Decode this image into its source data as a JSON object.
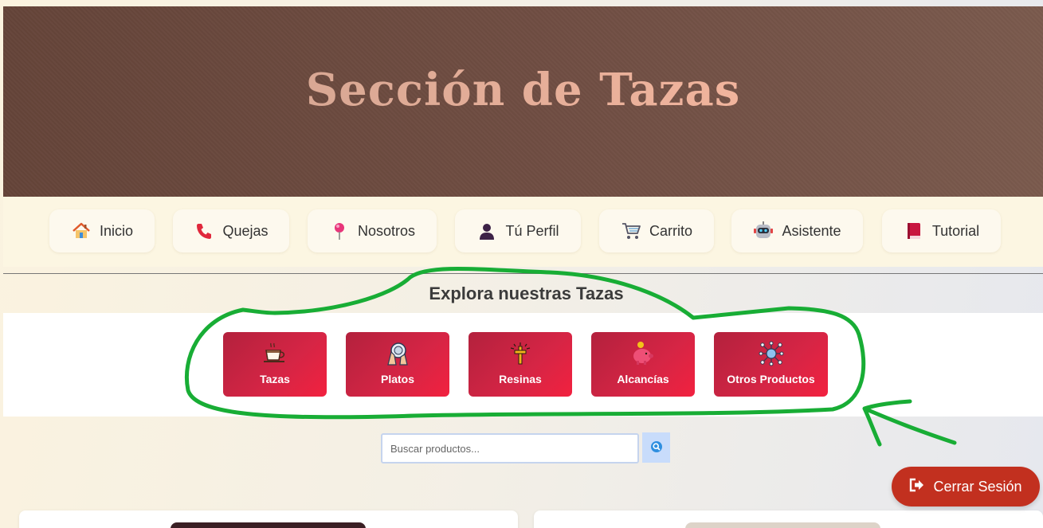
{
  "header": {
    "title": "Sección de Tazas"
  },
  "nav": {
    "items": [
      {
        "label": "Inicio",
        "icon": "home-icon"
      },
      {
        "label": "Quejas",
        "icon": "phone-icon"
      },
      {
        "label": "Nosotros",
        "icon": "map-pin-icon"
      },
      {
        "label": "Tú Perfil",
        "icon": "user-icon"
      },
      {
        "label": "Carrito",
        "icon": "cart-icon"
      },
      {
        "label": "Asistente",
        "icon": "robot-icon"
      },
      {
        "label": "Tutorial",
        "icon": "book-icon"
      }
    ]
  },
  "categories": {
    "title": "Explora nuestras Tazas",
    "items": [
      {
        "label": "Tazas",
        "icon": "cup-icon"
      },
      {
        "label": "Platos",
        "icon": "plate-icon"
      },
      {
        "label": "Resinas",
        "icon": "cross-icon"
      },
      {
        "label": "Alcancías",
        "icon": "piggy-bank-icon"
      },
      {
        "label": "Otros Productos",
        "icon": "network-icon"
      }
    ]
  },
  "search": {
    "placeholder": "Buscar productos...",
    "value": ""
  },
  "logout": {
    "label": "Cerrar Sesión"
  },
  "colors": {
    "header_bg": "#6f4d42",
    "title_gradient_start": "#d9a894",
    "title_gradient_end": "#f1b49d",
    "nav_bg": "#fcf6e2",
    "category_button": "#d62545",
    "logout_button": "#c2301f",
    "annotation_green": "#1aaa3a"
  }
}
